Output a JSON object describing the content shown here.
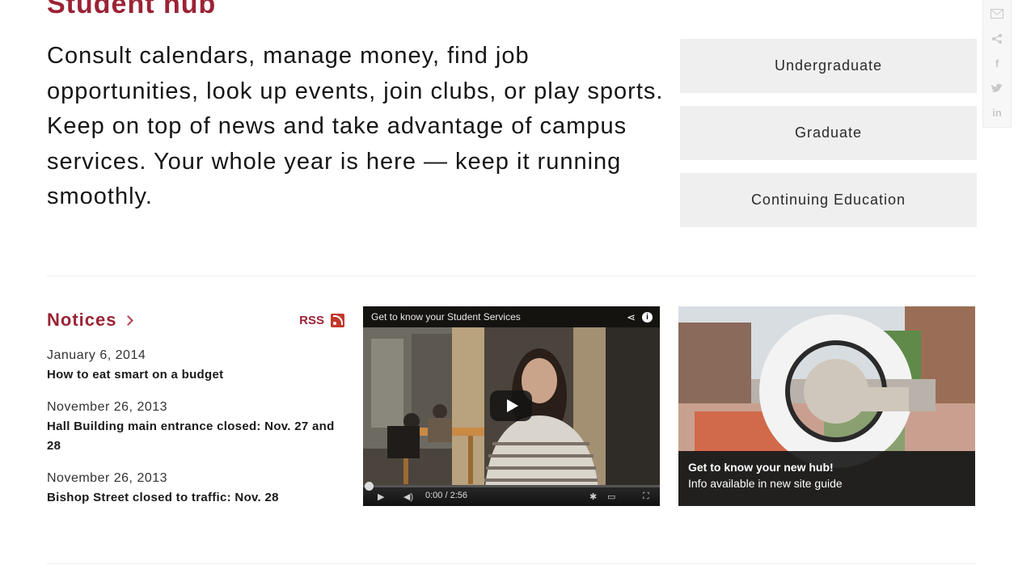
{
  "page": {
    "title": "Student hub",
    "intro": "Consult calendars, manage money, find job opportunities, look up events, join clubs, or play sports. Keep on top of news and take advantage of campus services. Your whole year is here — keep it running smoothly."
  },
  "programs": [
    {
      "label": "Undergraduate"
    },
    {
      "label": "Graduate"
    },
    {
      "label": "Continuing Education"
    }
  ],
  "share": {
    "icons": [
      "email-icon",
      "share-icon",
      "facebook-icon",
      "twitter-icon",
      "linkedin-icon"
    ]
  },
  "notices": {
    "title": "Notices",
    "rss_label": "RSS",
    "items": [
      {
        "date": "January 6, 2014",
        "title": "How to eat smart on a budget"
      },
      {
        "date": "November 26, 2013",
        "title": "Hall Building main entrance closed: Nov. 27 and 28"
      },
      {
        "date": "November 26, 2013",
        "title": "Bishop Street closed to traffic: Nov. 28"
      }
    ]
  },
  "video": {
    "title": "Get to know your Student Services",
    "time": "0:00 / 2:56"
  },
  "promo": {
    "line1": "Get to know your new hub!",
    "line2": "Info available in new site guide"
  },
  "colors": {
    "brand": "#9b2335",
    "button_bg": "#efefef"
  }
}
